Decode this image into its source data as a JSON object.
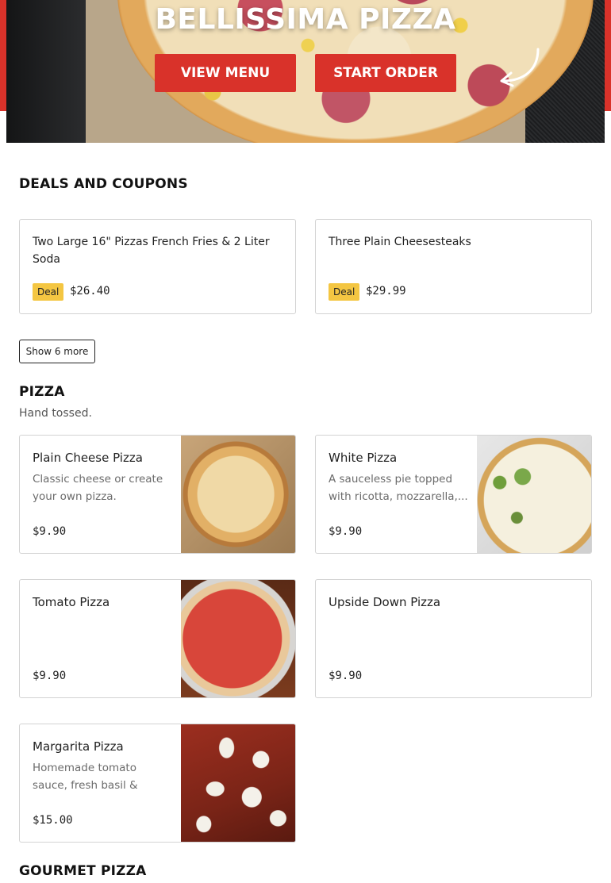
{
  "hero": {
    "title": "BELLISSIMA PIZZA",
    "view_menu_label": "VIEW MENU",
    "start_order_label": "START ORDER"
  },
  "deals": {
    "title": "DEALS AND COUPONS",
    "items": [
      {
        "name": "Two Large 16\" Pizzas French Fries & 2 Liter Soda",
        "badge": "Deal",
        "price": "$26.40"
      },
      {
        "name": "Three Plain Cheesesteaks",
        "badge": "Deal",
        "price": "$29.99"
      }
    ],
    "show_more_label": "Show 6 more"
  },
  "pizza": {
    "title": "PIZZA",
    "subtitle": "Hand tossed.",
    "items": [
      {
        "name": "Plain Cheese Pizza",
        "description": "Classic cheese or create your own pizza.",
        "price": "$9.90"
      },
      {
        "name": "White Pizza",
        "description": "A sauceless pie topped with ricotta, mozzarella,...",
        "price": "$9.90"
      },
      {
        "name": "Tomato Pizza",
        "description": "",
        "price": "$9.90"
      },
      {
        "name": "Upside Down Pizza",
        "description": "",
        "price": "$9.90"
      },
      {
        "name": "Margarita Pizza",
        "description": "Homemade tomato sauce, fresh basil & fresh...",
        "price": "$15.00"
      }
    ]
  },
  "gourmet": {
    "title": "GOURMET PIZZA"
  },
  "colors": {
    "accent": "#d9322a",
    "deal_badge": "#f4c642"
  }
}
